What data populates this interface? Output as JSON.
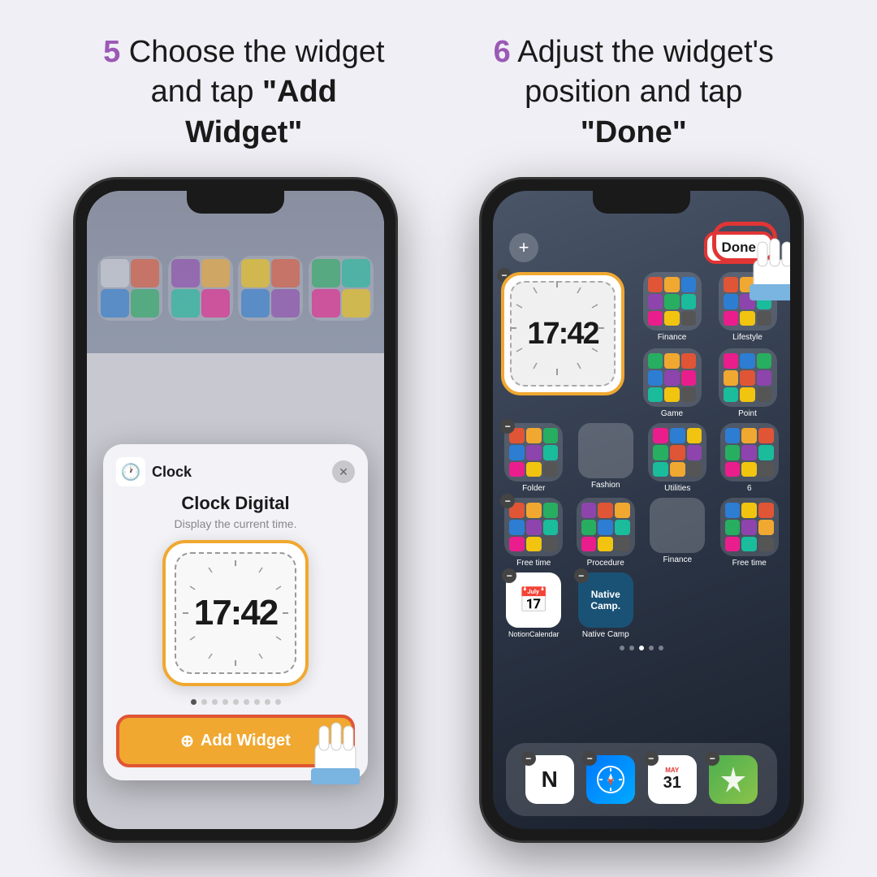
{
  "steps": [
    {
      "number": "5",
      "text1": "Choose the widget",
      "text2": "and tap ",
      "text3": "\"Add Widget\""
    },
    {
      "number": "6",
      "text1": "Adjust the widget's",
      "text2": "position and tap",
      "text3": "\"Done\""
    }
  ],
  "phone1": {
    "modal": {
      "app_name": "Clock",
      "widget_name": "Clock Digital",
      "widget_desc": "Display the current time.",
      "time_display": "17:42",
      "add_button": "Add Widget"
    },
    "dots": [
      "",
      "",
      "",
      "",
      "",
      "",
      "",
      "",
      ""
    ],
    "active_dot": 0
  },
  "phone2": {
    "top_add": "+",
    "done_button": "Done",
    "time_display": "17:42",
    "app_rows": [
      [
        {
          "label": "Finance",
          "color": "#2d7dd2"
        },
        {
          "label": "Lifestyle",
          "color": "#8e44ad"
        }
      ],
      [
        {
          "label": "Game",
          "color": "#27ae60"
        },
        {
          "label": "Point",
          "color": "#e91e8c"
        }
      ],
      [
        {
          "label": "Folder",
          "color": "folder"
        },
        {
          "label": "Fashion",
          "color": "#e05535"
        },
        {
          "label": "Utilities",
          "color": "#1abc9c"
        },
        {
          "label": "6",
          "color": "#f0a830"
        }
      ],
      [
        {
          "label": "Free time",
          "color": "#2d7dd2"
        },
        {
          "label": "Procedure",
          "color": "#8e44ad"
        },
        {
          "label": "Finance",
          "color": "#27ae60"
        },
        {
          "label": "Free time",
          "color": "#e05535"
        }
      ]
    ],
    "bottom_apps": [
      {
        "label": "NotionCalendar",
        "type": "notion"
      },
      {
        "label": "Native Camp",
        "type": "native"
      }
    ],
    "dock": [
      {
        "label": "Notion",
        "type": "notion"
      },
      {
        "label": "Safari",
        "type": "safari"
      },
      {
        "label": "Calendar",
        "type": "calendar"
      },
      {
        "label": "Spark",
        "type": "spark"
      }
    ]
  },
  "colors": {
    "step_number": "#9b59b6",
    "add_widget_bg": "#f0a830",
    "add_widget_border": "#e05535",
    "done_border": "#e03535",
    "widget_border": "#f0a830"
  }
}
